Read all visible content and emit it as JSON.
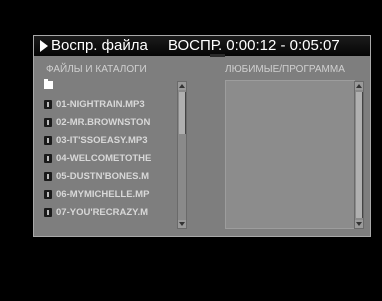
{
  "window": {
    "title": "Воспр. файла",
    "status": "ВОСПР. 0:00:12 - 0:05:07"
  },
  "files": {
    "header": "ФАЙЛЫ И КАТАЛОГИ",
    "items": [
      {
        "type": "folder",
        "label": ""
      },
      {
        "type": "file",
        "label": "01-NIGHTRAIN.MP3"
      },
      {
        "type": "file",
        "label": "02-MR.BROWNSTON"
      },
      {
        "type": "file",
        "label": "03-IT'SSOEASY.MP3"
      },
      {
        "type": "file",
        "label": "04-WELCOMETOTHE"
      },
      {
        "type": "file",
        "label": "05-DUSTN'BONES.M"
      },
      {
        "type": "file",
        "label": "06-MYMICHELLE.MP"
      },
      {
        "type": "file",
        "label": "07-YOU'RECRAZY.M"
      }
    ]
  },
  "favorites": {
    "header": "ЛЮБИМЫЕ/ПРОГРАММА"
  },
  "colors": {
    "background": "#000000",
    "panel": "#7e7e7e",
    "titlebar": "#0a0a0a",
    "text": "#ffffff"
  }
}
